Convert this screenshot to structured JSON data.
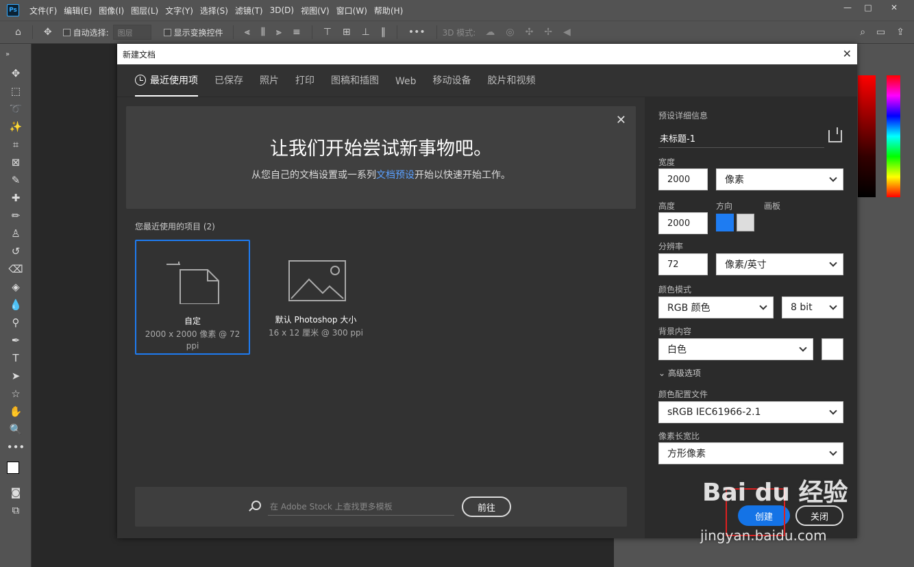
{
  "menu": [
    "文件(F)",
    "编辑(E)",
    "图像(I)",
    "图层(L)",
    "文字(Y)",
    "选择(S)",
    "滤镜(T)",
    "3D(D)",
    "视图(V)",
    "窗口(W)",
    "帮助(H)"
  ],
  "app_logo": "Ps",
  "options": {
    "auto_select_label": "自动选择:",
    "auto_select_value": "图层",
    "show_transform_label": "显示变换控件",
    "mode_3d_label": "3D 模式:"
  },
  "dialog": {
    "title": "新建文档",
    "tabs": [
      "最近使用项",
      "已保存",
      "照片",
      "打印",
      "图稿和插图",
      "Web",
      "移动设备",
      "胶片和视频"
    ],
    "banner_heading": "让我们开始尝试新事物吧。",
    "banner_sub_pre": "从您自己的文档设置或一系列",
    "banner_sub_link": "文档预设",
    "banner_sub_post": "开始以快速开始工作。",
    "recent_heading": "您最近使用的项目 (2)",
    "cards": [
      {
        "name": "自定",
        "meta": "2000 x 2000 像素 @ 72 ppi"
      },
      {
        "name": "默认 Photoshop 大小",
        "meta": "16 x 12 厘米 @ 300 ppi"
      }
    ],
    "search_placeholder": "在 Adobe Stock 上查找更多模板",
    "goto_label": "前往",
    "preset": {
      "heading": "预设详细信息",
      "name": "未标题-1",
      "width_label": "宽度",
      "width_value": "2000",
      "width_unit": "像素",
      "height_label": "高度",
      "height_value": "2000",
      "orientation_label": "方向",
      "artboard_label": "画板",
      "resolution_label": "分辨率",
      "resolution_value": "72",
      "resolution_unit": "像素/英寸",
      "color_mode_label": "颜色模式",
      "color_mode": "RGB 颜色",
      "bit_depth": "8 bit",
      "background_label": "背景内容",
      "background": "白色",
      "advanced_label": "高级选项",
      "profile_label": "颜色配置文件",
      "profile": "sRGB IEC61966-2.1",
      "aspect_label": "像素长宽比",
      "aspect": "方形像素",
      "create_label": "创建",
      "close_label": "关闭"
    }
  },
  "watermark": {
    "brand": "Bai du 经验",
    "url": "jingyan.baidu.com"
  },
  "colors": {
    "accent": "#1473e6",
    "dialog_bg": "#323232",
    "panel_bg": "#2b2b2b",
    "highlight": "#e02020"
  }
}
